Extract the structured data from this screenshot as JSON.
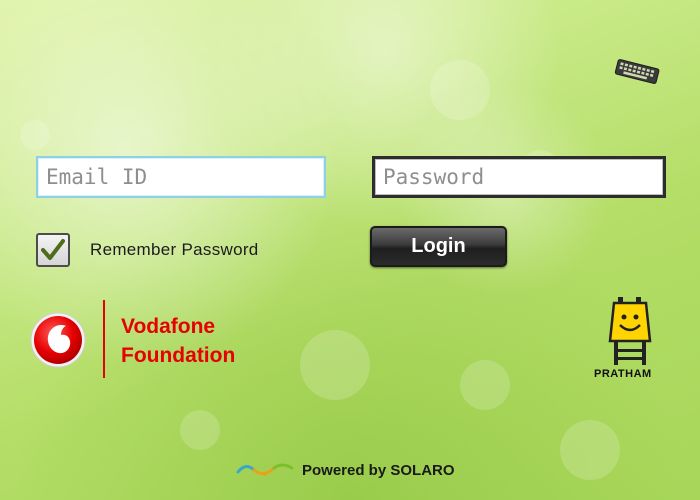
{
  "login": {
    "email_placeholder": "Email ID",
    "password_placeholder": "Password",
    "email_value": "",
    "password_value": "",
    "remember_label": "Remember Password",
    "remember_checked": true,
    "login_label": "Login"
  },
  "branding": {
    "vodafone_line1": "Vodafone",
    "vodafone_line2": "Foundation",
    "pratham_label": "PRATHAM",
    "powered_by": "Powered by SOLARO",
    "vodafone_red": "#e60000",
    "background_green": "#b3dd66"
  },
  "icons": {
    "keyboard": "keyboard-icon",
    "checkbox": "check-icon",
    "vodafone": "vodafone-logo",
    "pratham": "pratham-logo",
    "solaro": "solaro-logo"
  }
}
